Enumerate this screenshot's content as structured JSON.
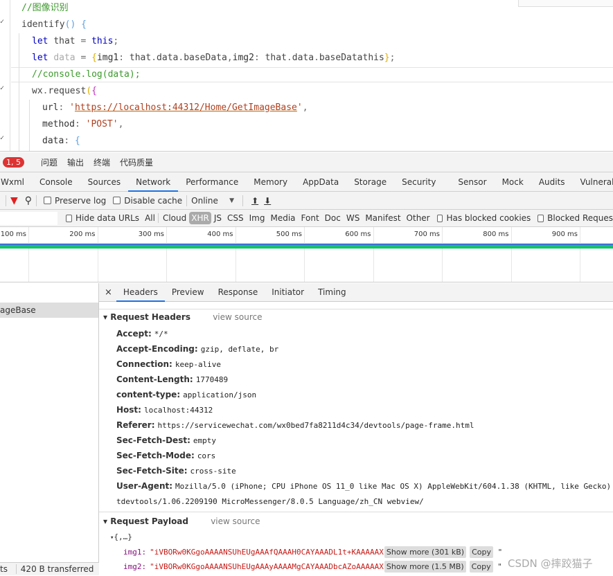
{
  "editor": {
    "lines": [
      [
        [
          "//图像识别",
          "c"
        ]
      ],
      [
        [
          "identify",
          "v"
        ],
        [
          "() ",
          "bb"
        ],
        [
          "{",
          "bb"
        ]
      ],
      [
        [
          "let ",
          "k"
        ],
        [
          "that ",
          "v"
        ],
        [
          "= ",
          "p"
        ],
        [
          "this",
          "k"
        ],
        [
          ";",
          "p"
        ]
      ],
      [
        [
          "let ",
          "k"
        ],
        [
          "data ",
          "dim"
        ],
        [
          "= ",
          "p"
        ],
        [
          "{",
          "br"
        ],
        [
          "img1",
          "pr"
        ],
        [
          ": ",
          "p"
        ],
        [
          "that",
          "v"
        ],
        [
          ".",
          "p"
        ],
        [
          "data",
          "v"
        ],
        [
          ".",
          "p"
        ],
        [
          "baseData",
          "v"
        ],
        [
          ",",
          "p"
        ],
        [
          "img2",
          "pr"
        ],
        [
          ": ",
          "p"
        ],
        [
          "that",
          "v"
        ],
        [
          ".",
          "p"
        ],
        [
          "data",
          "v"
        ],
        [
          ".",
          "p"
        ],
        [
          "baseDatathis",
          "v"
        ],
        [
          "}",
          "br"
        ],
        [
          ";",
          "p"
        ]
      ],
      [
        [
          "//console.log(data);",
          "c"
        ]
      ],
      [
        [
          "wx",
          "v"
        ],
        [
          ".",
          "p"
        ],
        [
          "request",
          "v"
        ],
        [
          "(",
          "br"
        ],
        [
          "{",
          "pk"
        ]
      ],
      [
        [
          "url",
          "pr"
        ],
        [
          ": ",
          "p"
        ],
        [
          "'",
          "s"
        ],
        [
          "https://localhost:44312/Home/GetImageBase",
          "u"
        ],
        [
          "'",
          "s"
        ],
        [
          ",",
          "p"
        ]
      ],
      [
        [
          "method",
          "pr"
        ],
        [
          ": ",
          "p"
        ],
        [
          "'POST'",
          "s"
        ],
        [
          ",",
          "p"
        ]
      ],
      [
        [
          "data",
          "pr"
        ],
        [
          ": ",
          "p"
        ],
        [
          "{",
          "bb"
        ]
      ]
    ]
  },
  "drawer": {
    "badge": "1, 5",
    "tabs": [
      "问题",
      "输出",
      "终端",
      "代码质量"
    ]
  },
  "main_tabs": [
    {
      "label": "Wxml"
    },
    {
      "label": "Console"
    },
    {
      "label": "Sources"
    },
    {
      "label": "Network",
      "active": true
    },
    {
      "label": "Performance"
    },
    {
      "label": "Memory"
    },
    {
      "label": "AppData"
    },
    {
      "label": "Storage"
    },
    {
      "label": "Security"
    },
    {
      "label": "Sensor"
    },
    {
      "label": "Mock"
    },
    {
      "label": "Audits"
    },
    {
      "label": "Vulnerability"
    }
  ],
  "toolbar": {
    "preserve_log": "Preserve log",
    "disable_cache": "Disable cache",
    "throttle": "Online"
  },
  "filter": {
    "hide_data_urls": "Hide data URLs",
    "types": [
      "All",
      "Cloud",
      "XHR",
      "JS",
      "CSS",
      "Img",
      "Media",
      "Font",
      "Doc",
      "WS",
      "Manifest",
      "Other"
    ],
    "active_type": "XHR",
    "has_blocked_cookies": "Has blocked cookies",
    "blocked_requests": "Blocked Reques"
  },
  "timeline": {
    "ticks": [
      "100 ms",
      "200 ms",
      "300 ms",
      "400 ms",
      "500 ms",
      "600 ms",
      "700 ms",
      "800 ms",
      "900 ms"
    ]
  },
  "request_list": {
    "selected": "ageBase"
  },
  "status": {
    "requests": "ts",
    "transferred": "420 B transferred"
  },
  "detail_tabs": [
    {
      "label": "Headers",
      "active": true
    },
    {
      "label": "Preview"
    },
    {
      "label": "Response"
    },
    {
      "label": "Initiator"
    },
    {
      "label": "Timing"
    }
  ],
  "request_headers": {
    "title": "Request Headers",
    "view_source": "view source",
    "rows": [
      {
        "k": "Accept:",
        "v": "*/*"
      },
      {
        "k": "Accept-Encoding:",
        "v": "gzip, deflate, br"
      },
      {
        "k": "Connection:",
        "v": "keep-alive"
      },
      {
        "k": "Content-Length:",
        "v": "1770489"
      },
      {
        "k": "content-type:",
        "v": "application/json"
      },
      {
        "k": "Host:",
        "v": "localhost:44312"
      },
      {
        "k": "Referer:",
        "v": "https://servicewechat.com/wx0bed7fa8211d4c34/devtools/page-frame.html"
      },
      {
        "k": "Sec-Fetch-Dest:",
        "v": "empty"
      },
      {
        "k": "Sec-Fetch-Mode:",
        "v": "cors"
      },
      {
        "k": "Sec-Fetch-Site:",
        "v": "cross-site"
      },
      {
        "k": "User-Agent:",
        "v": "Mozilla/5.0 (iPhone; CPU iPhone OS 11_0 like Mac OS X) AppleWebKit/604.1.38 (KHTML, like Gecko) Ve"
      },
      {
        "k": "",
        "v": "tdevtools/1.06.2209190 MicroMessenger/8.0.5 Language/zh_CN webview/"
      }
    ]
  },
  "request_payload": {
    "title": "Request Payload",
    "view_source": "view source",
    "root": "{,…}",
    "items": [
      {
        "key": "img1:",
        "value": "\"iVBORw0KGgoAAAANSUhEUgAAAfQAAAH0CAYAAADL1t+KAAAAAX",
        "show_more": "Show more (301 kB)",
        "copy": "Copy"
      },
      {
        "key": "img2:",
        "value": "\"iVBORw0KGgoAAAANSUhEUgAAAyAAAAMgCAYAAADbcAZoAAAAAX",
        "show_more": "Show more (1.5 MB)",
        "copy": "Copy"
      }
    ]
  },
  "watermark": "CSDN @摔跤猫子",
  "colors": {
    "accent": "#1a73e8",
    "badge": "#dd3333",
    "waterfall": "#15c26b",
    "filter_icon": "#e02020"
  }
}
